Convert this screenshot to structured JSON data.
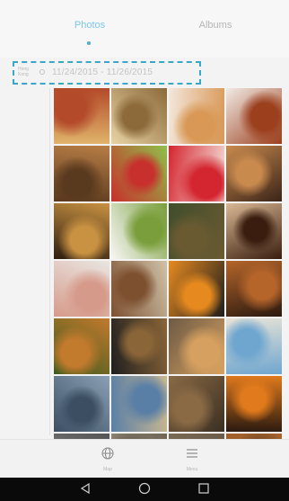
{
  "tabs": {
    "photos": "Photos",
    "albums": "Albums"
  },
  "timeline": {
    "section_label": "Hong Kong",
    "date_range": "11/24/2015 - 11/26/2015"
  },
  "photos": [
    {
      "subject": "photo-collage",
      "colors": [
        "#b34a2a",
        "#e0b36a"
      ]
    },
    {
      "subject": "photo-collage",
      "colors": [
        "#8c6a3a",
        "#e8d3a4"
      ]
    },
    {
      "subject": "donuts",
      "colors": [
        "#d99856",
        "#f3e7dc"
      ]
    },
    {
      "subject": "pie",
      "colors": [
        "#9b3f1d",
        "#f1eae4"
      ]
    },
    {
      "subject": "chestnut-basket",
      "colors": [
        "#5a3a1f",
        "#b77d45"
      ]
    },
    {
      "subject": "fruit-skewer",
      "colors": [
        "#c7302c",
        "#8fbf4a"
      ]
    },
    {
      "subject": "bell-peppers",
      "colors": [
        "#d42630",
        "#f4e6de"
      ]
    },
    {
      "subject": "donuts",
      "colors": [
        "#c98a4e",
        "#3a2418"
      ]
    },
    {
      "subject": "baguettes",
      "colors": [
        "#c99242",
        "#2d1d10"
      ]
    },
    {
      "subject": "salad-plate",
      "colors": [
        "#7a9e3b",
        "#f7f7f5"
      ]
    },
    {
      "subject": "buffet",
      "colors": [
        "#6a5a32",
        "#3f4e2b"
      ]
    },
    {
      "subject": "chocolate-cake",
      "colors": [
        "#3a1d0f",
        "#d9b894"
      ]
    },
    {
      "subject": "sashimi",
      "colors": [
        "#d69a8a",
        "#e9e6e2"
      ]
    },
    {
      "subject": "bread-loaves",
      "colors": [
        "#7d5030",
        "#cfc2a8"
      ]
    },
    {
      "subject": "fruit-stack",
      "colors": [
        "#e68a1f",
        "#1e1e1e"
      ]
    },
    {
      "subject": "croissants",
      "colors": [
        "#b5652a",
        "#2b1a10"
      ]
    },
    {
      "subject": "soup-bowl",
      "colors": [
        "#c27a2d",
        "#3d5a1e"
      ]
    },
    {
      "subject": "teapot-set",
      "colors": [
        "#8a6538",
        "#1f1f1f"
      ]
    },
    {
      "subject": "beach-sunset",
      "colors": [
        "#d6a160",
        "#6d5a45"
      ]
    },
    {
      "subject": "beach-chair",
      "colors": [
        "#6fa6cf",
        "#e8e3d7"
      ]
    },
    {
      "subject": "cloudy-sky",
      "colors": [
        "#3c4f62",
        "#8aa0b4"
      ]
    },
    {
      "subject": "boardwalk",
      "colors": [
        "#5a7fa6",
        "#c9b78f"
      ]
    },
    {
      "subject": "bicycle",
      "colors": [
        "#8a6a45",
        "#3a2f22"
      ]
    },
    {
      "subject": "pumpkins",
      "colors": [
        "#e07a1c",
        "#2a1a10"
      ]
    },
    {
      "subject": "partial-row",
      "colors": [
        "#555555",
        "#777777"
      ]
    },
    {
      "subject": "partial-row",
      "colors": [
        "#6b6354",
        "#8d8270"
      ]
    },
    {
      "subject": "partial-row",
      "colors": [
        "#5a4a3a",
        "#7a6a55"
      ]
    },
    {
      "subject": "partial-row",
      "colors": [
        "#7a4a25",
        "#a8642c"
      ]
    }
  ],
  "bottom_bar": {
    "map": "Map",
    "menu": "Menu"
  }
}
